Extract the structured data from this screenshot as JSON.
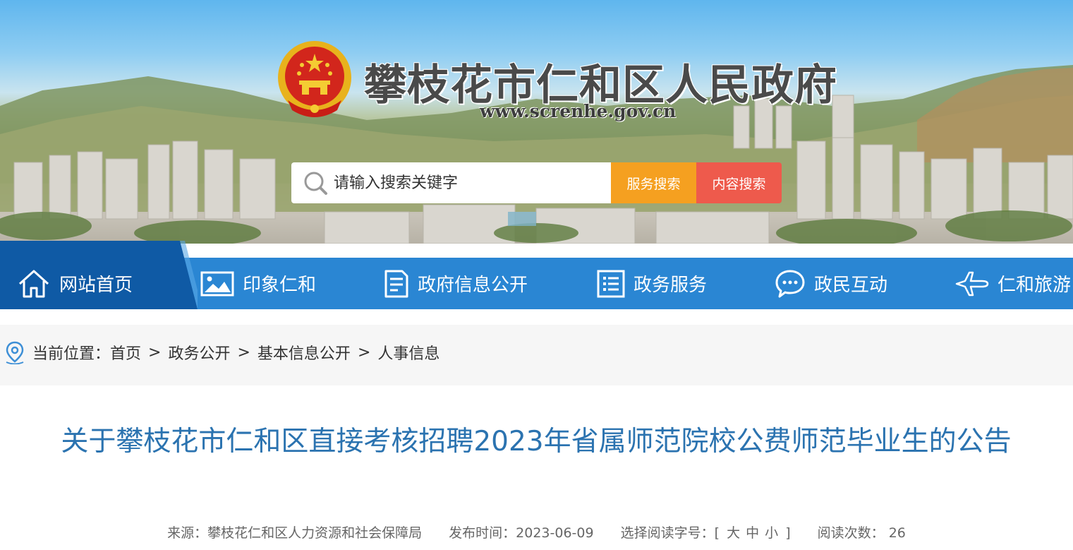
{
  "header": {
    "site_title": "攀枝花市仁和区人民政府",
    "site_url": "www.screnhe.gov.cn"
  },
  "search": {
    "placeholder": "请输入搜索关键字",
    "service_button": "服务搜索",
    "content_button": "内容搜索"
  },
  "nav": {
    "items": [
      {
        "label": "网站首页",
        "icon": "home-icon"
      },
      {
        "label": "印象仁和",
        "icon": "picture-icon"
      },
      {
        "label": "政府信息公开",
        "icon": "document-icon"
      },
      {
        "label": "政务服务",
        "icon": "list-icon"
      },
      {
        "label": "政民互动",
        "icon": "chat-icon"
      },
      {
        "label": "仁和旅游",
        "icon": "airplane-icon"
      }
    ],
    "active_color": "#0f5aa5",
    "bar_color": "#2a86d3"
  },
  "breadcrumb": {
    "prefix": "当前位置：",
    "items": [
      "首页",
      "政务公开",
      "基本信息公开",
      "人事信息"
    ],
    "separator": ">"
  },
  "article": {
    "title": "关于攀枝花市仁和区直接考核招聘2023年省属师范院校公费师范毕业生的公告",
    "source_label": "来源：",
    "source": "攀枝花仁和区人力资源和社会保障局",
    "date_label": "发布时间：",
    "date": "2023-06-09",
    "font_size_label": "选择阅读字号：",
    "font_sizes": [
      "大",
      "中",
      "小"
    ],
    "views_label": "阅读次数：",
    "views": "26"
  },
  "colors": {
    "title_blue": "#2b73b0",
    "search_orange": "#f5a020",
    "search_red": "#ee5a4c"
  }
}
